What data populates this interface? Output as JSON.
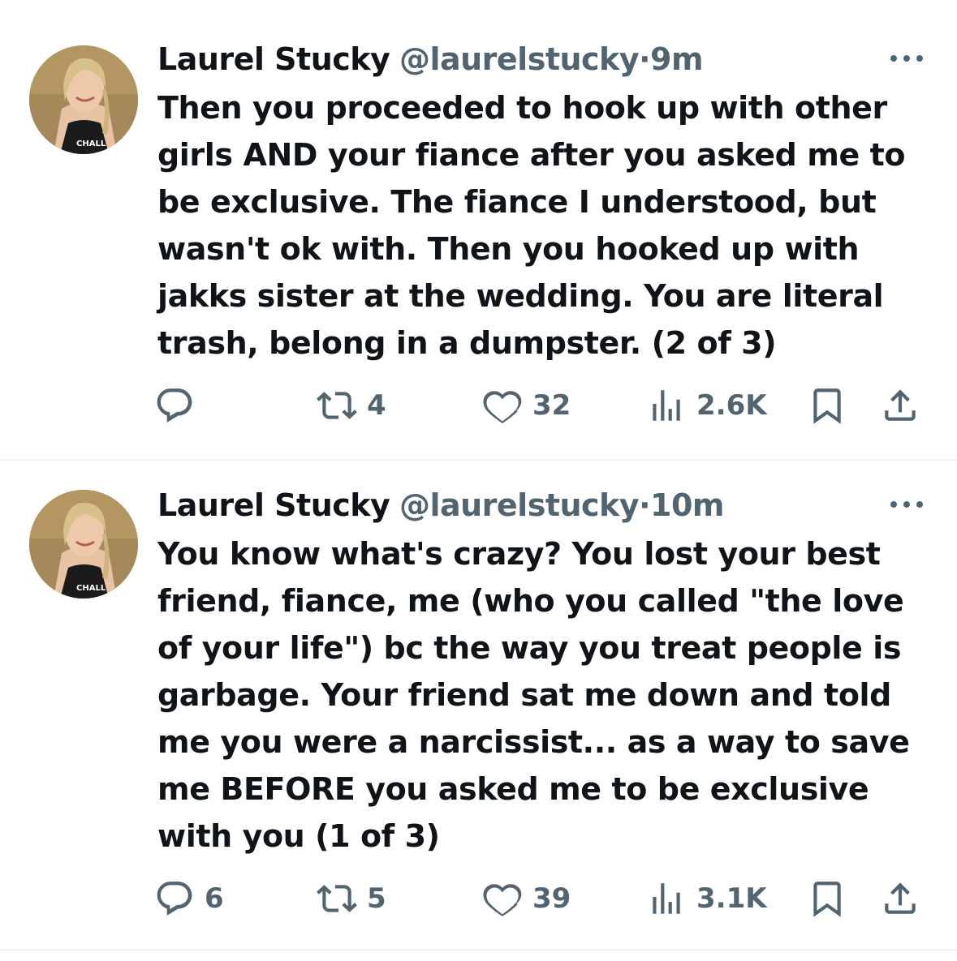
{
  "tweets": [
    {
      "name": "Laurel Stucky",
      "handle": "@laurelstucky",
      "separator": "·",
      "time": "9m",
      "text": "Then you proceeded to hook up with other girls AND your fiance after you asked me to be exclusive. The fiance I understood, but wasn't ok with. Then you hooked up with jakks sister at the wedding. You are literal trash, belong in a dumpster. (2 of 3)",
      "replies": "",
      "retweets": "4",
      "likes": "32",
      "views": "2.6K",
      "icons": [
        "reply-icon",
        "retweet-icon",
        "like-icon",
        "views-icon",
        "bookmark-icon",
        "share-icon"
      ]
    },
    {
      "name": "Laurel Stucky",
      "handle": "@laurelstucky",
      "separator": "·",
      "time": "10m",
      "text": "You know what's crazy? You lost your best friend, fiance, me (who you called \"the love of your life\") bc the way you treat people is garbage. Your friend sat me down and told me you were a narcissist... as a way to save me BEFORE you asked me to be exclusive with you (1 of 3)",
      "replies": "6",
      "retweets": "5",
      "likes": "39",
      "views": "3.1K",
      "icons": [
        "reply-icon",
        "retweet-icon",
        "like-icon",
        "views-icon",
        "bookmark-icon",
        "share-icon"
      ]
    }
  ],
  "colors": {
    "text": "#0f1419",
    "secondary": "#536471",
    "divider": "#eff3f4"
  }
}
